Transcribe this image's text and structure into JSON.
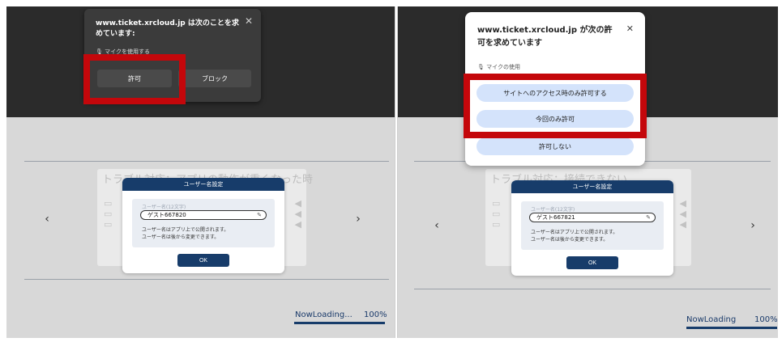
{
  "left": {
    "popup": {
      "title": "www.ticket.xrcloud.jp は次のことを求めています:",
      "close": "✕",
      "mic_icon": "mic-icon",
      "mic_label": "マイクを使用する",
      "allow_label": "許可",
      "block_label": "ブロック"
    },
    "stage_title": "トラブル対応：アプリの動作が重くなった時",
    "modal": {
      "header": "ユーザー名設定",
      "field_label": "ユーザー名(12文字)",
      "field_value": "ゲスト667820",
      "note1": "ユーザー名はアプリ上で公開されます。",
      "note2": "ユーザー名は後から変更できます。",
      "ok_label": "OK"
    },
    "prev": "‹",
    "next": "›",
    "loading_text": "NowLoading...",
    "loading_percent": "100%"
  },
  "right": {
    "popup": {
      "title": "www.ticket.xrcloud.jp が次の許可を求めています",
      "close": "✕",
      "mic_icon": "mic-icon",
      "mic_label": "マイクの使用",
      "option1": "サイトへのアクセス時のみ許可する",
      "option2": "今回のみ許可",
      "option3": "許可しない"
    },
    "stage_title": "トラブル対応：接続できない",
    "modal": {
      "header": "ユーザー名設定",
      "field_label": "ユーザー名(12文字)",
      "field_value": "ゲスト667821",
      "note1": "ユーザー名はアプリ上で公開されます。",
      "note2": "ユーザー名は後から変更できます。",
      "ok_label": "OK"
    },
    "prev": "‹",
    "next": "›",
    "loading_text": "NowLoading",
    "loading_percent": "100%"
  },
  "colors": {
    "highlight": "#c4070b",
    "modal_header": "#173c6a",
    "dark_bg": "#2b2b2b",
    "gray_bg": "#d8d8d8",
    "pill": "#d4e3fb"
  }
}
